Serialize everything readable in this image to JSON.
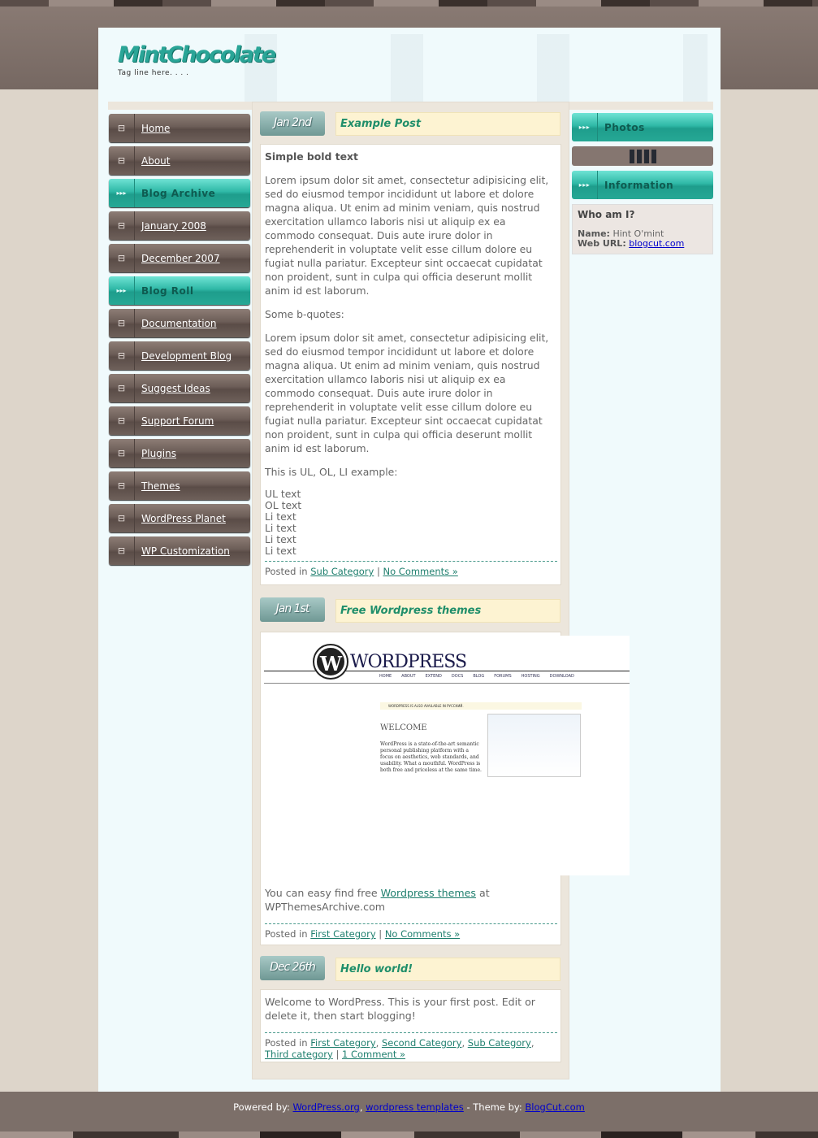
{
  "site": {
    "title": "MintChocolate",
    "tagline": "Tag line here. . . ."
  },
  "nav": [
    {
      "label": "Home",
      "type": "link"
    },
    {
      "label": "About",
      "type": "link"
    },
    {
      "label": "Blog Archive",
      "type": "heading"
    },
    {
      "label": "January 2008",
      "type": "link"
    },
    {
      "label": "December 2007",
      "type": "link"
    },
    {
      "label": "Blog Roll",
      "type": "heading"
    },
    {
      "label": "Documentation",
      "type": "link"
    },
    {
      "label": "Development Blog",
      "type": "link"
    },
    {
      "label": "Suggest Ideas",
      "type": "link"
    },
    {
      "label": "Support Forum",
      "type": "link"
    },
    {
      "label": "Plugins",
      "type": "link"
    },
    {
      "label": "Themes",
      "type": "link"
    },
    {
      "label": "WordPress Planet",
      "type": "link"
    },
    {
      "label": "WP Customization",
      "type": "link"
    }
  ],
  "posts": [
    {
      "date": "Jan 2nd",
      "title": "Example Post",
      "bold": "Simple bold text",
      "p1": "Lorem ipsum dolor sit amet, consectetur adipisicing elit, sed do eiusmod tempor incididunt ut labore et dolore magna aliqua. Ut enim ad minim veniam, quis nostrud exercitation ullamco laboris nisi ut aliquip ex ea commodo consequat. Duis aute irure dolor in reprehenderit in voluptate velit esse cillum dolore eu fugiat nulla pariatur. Excepteur sint occaecat cupidatat non proident, sunt in culpa qui officia deserunt mollit anim id est laborum.",
      "p2": "Some b-quotes:",
      "p3": "Lorem ipsum dolor sit amet, consectetur adipisicing elit, sed do eiusmod tempor incididunt ut labore et dolore magna aliqua. Ut enim ad minim veniam, quis nostrud exercitation ullamco laboris nisi ut aliquip ex ea commodo consequat. Duis aute irure dolor in reprehenderit in voluptate velit esse cillum dolore eu fugiat nulla pariatur. Excepteur sint occaecat cupidatat non proident, sunt in culpa qui officia deserunt mollit anim id est laborum.",
      "p4": "This is UL, OL, LI example:",
      "list": [
        "UL text",
        "OL text",
        "Li text",
        "Li text",
        "Li text",
        "Li text"
      ],
      "posted_in": "Posted in",
      "categories": [
        "Sub Category"
      ],
      "comments": "No Comments »"
    },
    {
      "date": "Jan 1st",
      "title": "Free Wordpress themes",
      "text_before": "You can easy find free ",
      "link": "Wordpress themes",
      "text_after": " at WPThemesArchive.com",
      "posted_in": "Posted in",
      "categories": [
        "First Category"
      ],
      "comments": "No Comments »",
      "image": {
        "brand": "WORDPRESS",
        "nav": [
          "HOME",
          "ABOUT",
          "EXTEND",
          "DOCS",
          "BLOG",
          "FORUMS",
          "HOSTING",
          "DOWNLOAD"
        ],
        "notice": "WORDPRESS IS ALSO AVAILABLE IN РУССКИЙ.",
        "welcome": "WELCOME",
        "intro": "WordPress is a state-of-the-art semantic personal publishing platform with a focus on aesthetics, web standards, and usability. What a mouthful. WordPress is both free and priceless at the same time."
      }
    },
    {
      "date": "Dec 26th",
      "title": "Hello world!",
      "text": "Welcome to WordPress. This is your first post. Edit or delete it, then start blogging!",
      "posted_in": "Posted in",
      "categories": [
        "First Category",
        "Second Category",
        "Sub Category",
        "Third category"
      ],
      "comments": "1 Comment »"
    }
  ],
  "right": {
    "photos": "Photos",
    "information": "Information",
    "who_title": "Who am I?",
    "name_label": "Name:",
    "name": "Hint O'mint",
    "url_label": "Web URL:",
    "url": "blogcut.com"
  },
  "footer": {
    "powered": "Powered by: ",
    "wp": "WordPress.org",
    "sep": ", ",
    "templates": "wordpress templates",
    "theme": " - Theme by: ",
    "blogcut": "BlogCut.com"
  }
}
